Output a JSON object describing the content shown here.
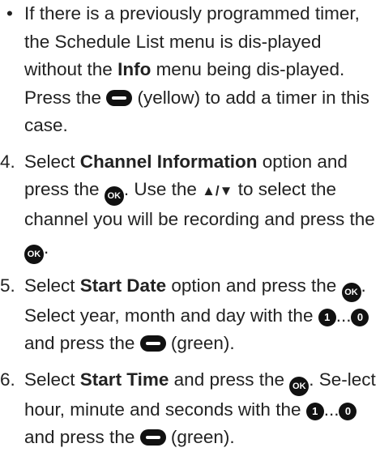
{
  "bullet": {
    "marker": "•",
    "t1": "If there is a previously programmed timer, the Schedule List menu is dis-played without the ",
    "b1": "Info",
    "t2": " menu being dis-played. Press the ",
    "t3": " (yellow) to add a timer in this case."
  },
  "step4": {
    "num": "4.",
    "t1": "Select ",
    "b1": "Channel Information",
    "t2": " option and press the ",
    "t3": ". Use the ",
    "t4": " to select the channel you will be recording and press the ",
    "t5": "."
  },
  "step5": {
    "num": "5.",
    "t1": "Select ",
    "b1": "Start Date",
    "t2": " option and press the ",
    "t3": ". Select year, month and day with the ",
    "t4": " and press the ",
    "t5": " (green)."
  },
  "step6": {
    "num": "6.",
    "t1": "Select ",
    "b1": "Start Time",
    "t2": " and press the ",
    "t3": ". Se-lect hour, minute and seconds with the ",
    "t4": " and press the ",
    "t5": " (green)."
  },
  "icons": {
    "ok_label": "OK",
    "arrows_label": "▲/▼",
    "num_first": "1",
    "num_last": "0",
    "ellipsis": "...",
    "yellow_key": "color-key-icon",
    "green_key": "color-key-icon",
    "ok_button": "ok-button-icon",
    "up_down": "up-down-arrows-icon",
    "number_keys": "number-key-icon"
  }
}
